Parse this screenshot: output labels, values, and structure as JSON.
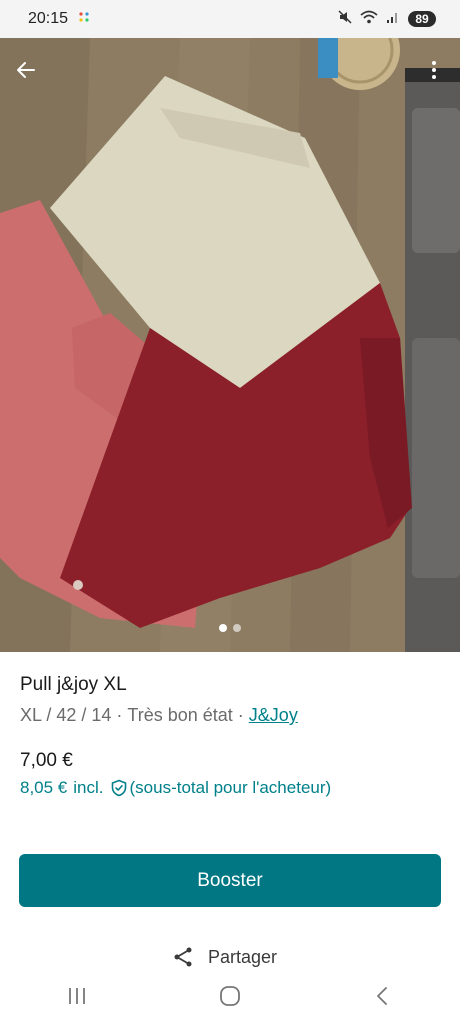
{
  "status_bar": {
    "time": "20:15",
    "battery": "89",
    "icons": [
      "app-notification-icon",
      "mute-icon",
      "wifi-icon",
      "signal-icon"
    ]
  },
  "photo": {
    "image_count": 2,
    "active_index": 0,
    "icons": {
      "back": "arrow-left-icon",
      "menu": "more-vertical-icon"
    }
  },
  "item": {
    "title": "Pull j&joy XL",
    "size": "XL / 42 / 14",
    "separator": "·",
    "condition": "Très bon état",
    "brand": "J&Joy",
    "price": "7,00 €",
    "buyer_price": "8,05 €",
    "incl_label": "incl.",
    "buyer_note": "(sous-total pour l'acheteur)"
  },
  "actions": {
    "booster_label": "Booster",
    "share_label": "Partager"
  },
  "colors": {
    "accent": "#007782",
    "link": "#00808a"
  }
}
